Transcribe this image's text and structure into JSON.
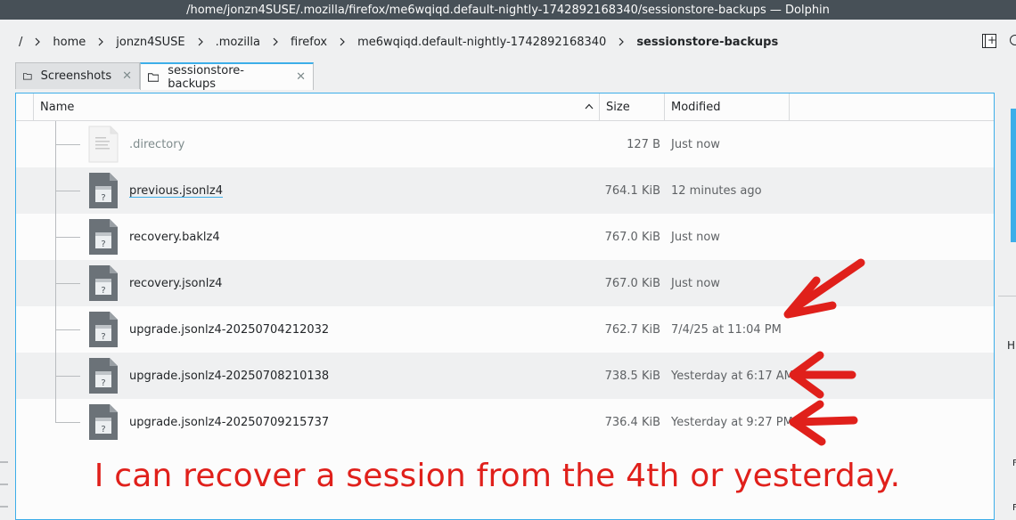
{
  "window": {
    "title": "/home/jonzn4SUSE/.mozilla/firefox/me6wqiqd.default-nightly-1742892168340/sessionstore-backups — Dolphin"
  },
  "breadcrumb": [
    "/",
    "home",
    "jonzn4SUSE",
    ".mozilla",
    "firefox",
    "me6wqiqd.default-nightly-1742892168340",
    "sessionstore-backups"
  ],
  "tabs": [
    {
      "label": "Screenshots",
      "active": false
    },
    {
      "label": "sessionstore-backups",
      "active": true
    }
  ],
  "columns": {
    "name": "Name",
    "size": "Size",
    "modified": "Modified"
  },
  "files": [
    {
      "name": ".directory",
      "size": "127 B",
      "modified": "Just now",
      "icon": "text-file-icon"
    },
    {
      "name": "previous.jsonlz4",
      "size": "764.1 KiB",
      "modified": "12 minutes ago",
      "icon": "unknown-file-icon"
    },
    {
      "name": "recovery.baklz4",
      "size": "767.0 KiB",
      "modified": "Just now",
      "icon": "unknown-file-icon"
    },
    {
      "name": "recovery.jsonlz4",
      "size": "767.0 KiB",
      "modified": "Just now",
      "icon": "unknown-file-icon"
    },
    {
      "name": "upgrade.jsonlz4-20250704212032",
      "size": "762.7 KiB",
      "modified": "7/4/25 at 11:04 PM",
      "icon": "unknown-file-icon"
    },
    {
      "name": "upgrade.jsonlz4-20250708210138",
      "size": "738.5 KiB",
      "modified": "Yesterday at 6:17 AM",
      "icon": "unknown-file-icon"
    },
    {
      "name": "upgrade.jsonlz4-20250709215737",
      "size": "736.4 KiB",
      "modified": "Yesterday at 9:27 PM",
      "icon": "unknown-file-icon"
    }
  ],
  "side_panel": {
    "text1": "Hi",
    "text2": "F",
    "text3": "F"
  },
  "annotation": {
    "text": "I can recover a session from the 4th or yesterday.",
    "color": "#e0201b"
  },
  "colors": {
    "accent": "#3daee9",
    "titlebar": "#475057"
  }
}
